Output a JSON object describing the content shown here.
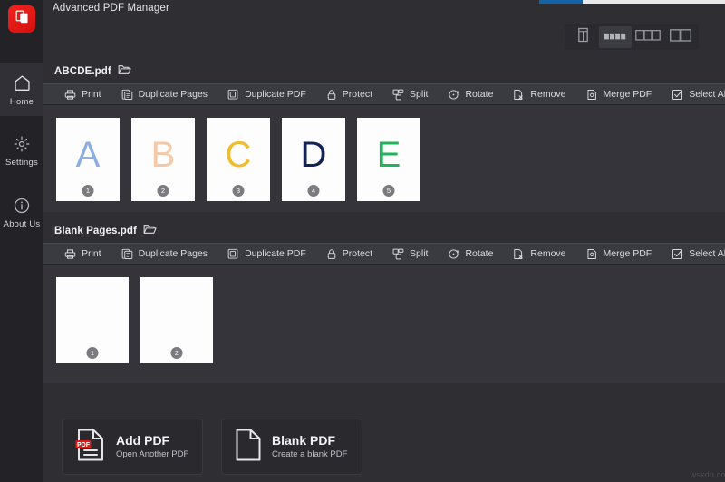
{
  "app": {
    "title": "Advanced PDF Manager",
    "logo_icon": "pdf-app-logo-icon",
    "accent_color": "#e01b17",
    "background_color": "#2e2e33",
    "toolbar_color": "#3a3a41",
    "watermark": "wsxdn.com"
  },
  "progress": {
    "percent": 23,
    "fill_color": "#1464a5",
    "track_color": "#e9e9ea"
  },
  "sidebar": {
    "items": [
      {
        "label": "Home",
        "icon": "home-icon",
        "active": true
      },
      {
        "label": "Settings",
        "icon": "gear-icon",
        "active": false
      },
      {
        "label": "About Us",
        "icon": "info-icon",
        "active": false
      }
    ]
  },
  "view_modes": [
    {
      "name": "single-page-view",
      "icon": "single-page-icon",
      "active": false
    },
    {
      "name": "list-view",
      "icon": "list-rows-icon",
      "active": true
    },
    {
      "name": "three-column-view",
      "icon": "three-columns-icon",
      "active": false
    },
    {
      "name": "two-column-view",
      "icon": "two-columns-icon",
      "active": false
    }
  ],
  "toolbar_items": [
    {
      "label": "Print",
      "icon": "printer-icon"
    },
    {
      "label": "Duplicate Pages",
      "icon": "duplicate-pages-icon"
    },
    {
      "label": "Duplicate PDF",
      "icon": "duplicate-pdf-icon"
    },
    {
      "label": "Protect",
      "icon": "lock-icon"
    },
    {
      "label": "Split",
      "icon": "split-icon"
    },
    {
      "label": "Rotate",
      "icon": "rotate-icon"
    },
    {
      "label": "Remove",
      "icon": "remove-icon"
    },
    {
      "label": "Merge PDF",
      "icon": "merge-pdf-icon"
    },
    {
      "label": "Select All",
      "icon": "checkbox-icon"
    }
  ],
  "files": [
    {
      "name": "ABCDE.pdf",
      "folder_icon": "open-folder-icon",
      "pages": [
        {
          "number": "1",
          "letter": "A",
          "color": "#8aaee0"
        },
        {
          "number": "2",
          "letter": "B",
          "color": "#f3c9a8"
        },
        {
          "number": "3",
          "letter": "C",
          "color": "#f0bc2a"
        },
        {
          "number": "4",
          "letter": "D",
          "color": "#122457"
        },
        {
          "number": "5",
          "letter": "E",
          "color": "#21b35a"
        }
      ]
    },
    {
      "name": "Blank Pages.pdf",
      "folder_icon": "open-folder-icon",
      "pages": [
        {
          "number": "1",
          "letter": "",
          "color": "#ffffff"
        },
        {
          "number": "2",
          "letter": "",
          "color": "#ffffff"
        }
      ]
    }
  ],
  "actions": [
    {
      "title": "Add PDF",
      "subtitle": "Open Another PDF",
      "icon": "pdf-document-icon",
      "badge": "PDF",
      "badge_color": "#e01b17"
    },
    {
      "title": "Blank PDF",
      "subtitle": "Create a blank PDF",
      "icon": "blank-document-icon",
      "badge": "",
      "badge_color": ""
    }
  ]
}
